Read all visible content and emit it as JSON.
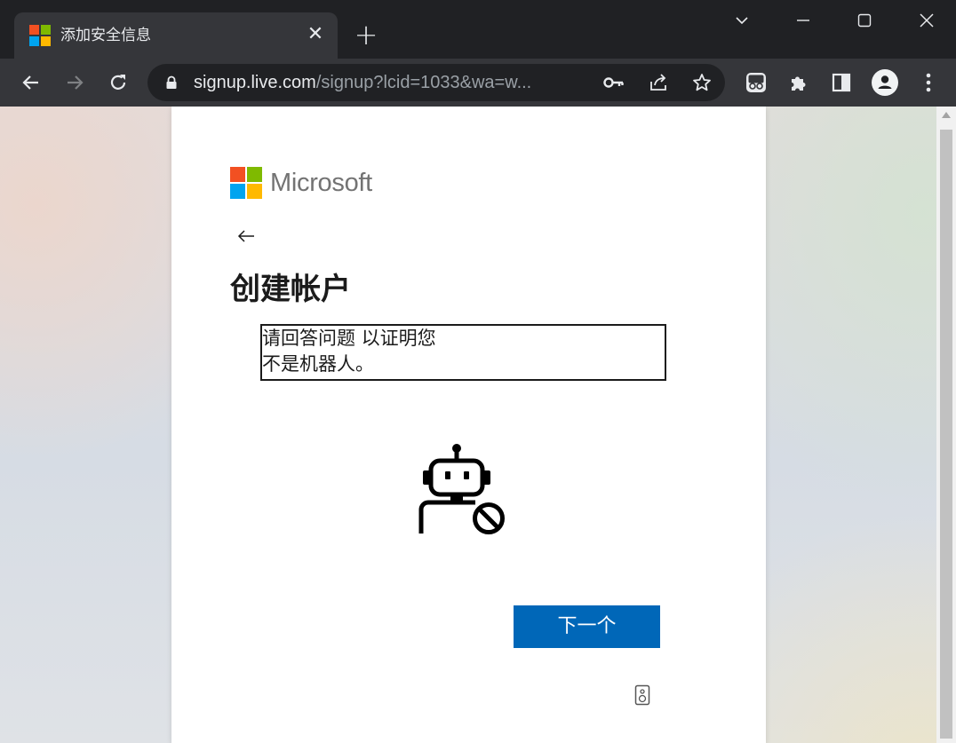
{
  "browser": {
    "tab": {
      "title": "添加安全信息",
      "close_glyph": "✕"
    },
    "new_tab_glyph": "+",
    "address": {
      "domain": "signup.live.com",
      "rest": "/signup?lcid=1033&wa=w..."
    },
    "toolbar_icons": [
      "back-icon",
      "forward-icon",
      "reload-icon",
      "lock-icon",
      "key-icon",
      "share-icon",
      "star-icon",
      "extension-icon",
      "puzzle-icon",
      "side-panel-icon",
      "profile-icon",
      "menu-icon"
    ],
    "window_controls": [
      "chevron-down-icon",
      "minimize-icon",
      "maximize-icon",
      "close-icon"
    ]
  },
  "page": {
    "logo": {
      "text": "Microsoft",
      "colors": [
        "#f25022",
        "#7fba00",
        "#00a4ef",
        "#ffb900"
      ]
    },
    "heading": "创建帐户",
    "challenge_lines": [
      "请回答问题 以证明您",
      "不是机器人。"
    ],
    "next_button": "下一个",
    "accent": "#0067b8"
  }
}
